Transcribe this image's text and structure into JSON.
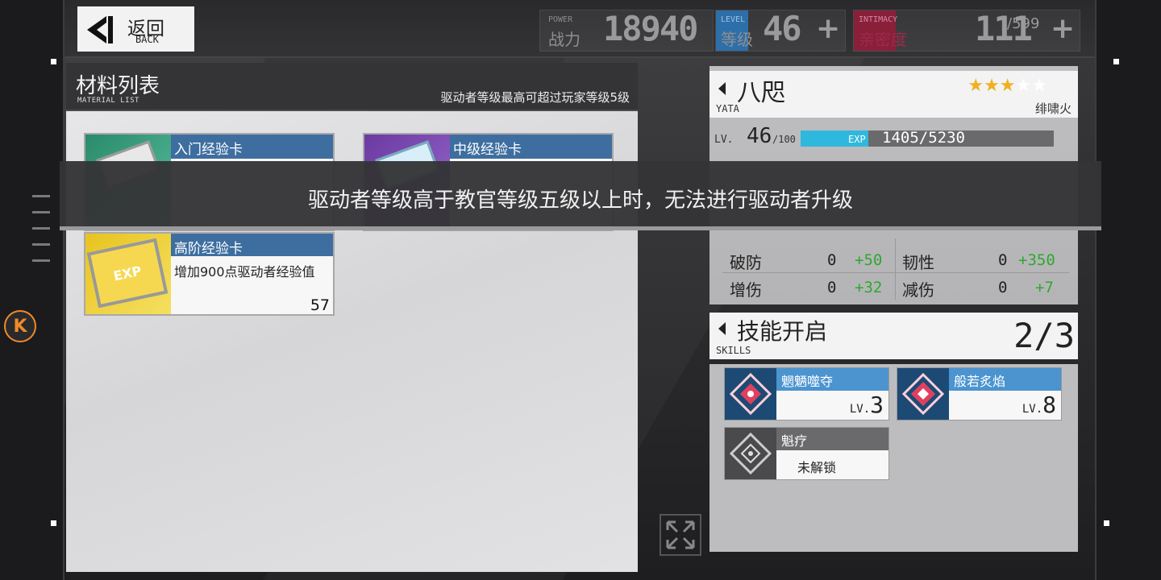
{
  "back": {
    "label": "返回",
    "sub": "BACK"
  },
  "top_stats": {
    "power": {
      "en": "POWER",
      "zh": "战力",
      "value": "18940"
    },
    "level": {
      "en": "LEVEL",
      "zh": "等级",
      "value": "46",
      "plus": "+"
    },
    "intimacy": {
      "en": "INTIMACY",
      "zh": "亲密度",
      "value": "111",
      "max": "/599",
      "plus": "+"
    }
  },
  "material_panel": {
    "title": "材料列表",
    "title_en": "MATERIAL LIST",
    "note": "驱动者等级最高可超过玩家等级5级",
    "items": [
      {
        "name": "入门经验卡",
        "color": "#2a8a6a"
      },
      {
        "name": "中级经验卡",
        "color": "#6a3aa0"
      },
      {
        "name": "高阶经验卡",
        "desc": "增加900点驱动者经验值",
        "count": "57",
        "color": "#e8c320",
        "img_text": "EXP"
      }
    ]
  },
  "character": {
    "name": "八咫",
    "name_en": "YATA",
    "attribute": "绯啸火",
    "stars_filled": 3,
    "stars_total": 5,
    "lv_label": "LV.",
    "level": "46",
    "level_max": "/100",
    "exp_label": "EXP",
    "exp_text": "1405/5230",
    "exp_current": 1405,
    "exp_total": 5230,
    "stats": [
      {
        "label": "破防",
        "value": "0",
        "add": "+50"
      },
      {
        "label": "韧性",
        "value": "0",
        "add": "+350"
      },
      {
        "label": "增伤",
        "value": "0",
        "add": "+32"
      },
      {
        "label": "减伤",
        "value": "0",
        "add": "+7"
      }
    ]
  },
  "banner": {
    "text": "驱动者等级高于教官等级五级以上时，无法进行驱动者升级"
  },
  "skills": {
    "title": "技能开启",
    "title_en": "SKILLS",
    "count": "2/3",
    "items": [
      {
        "name": "魍魉噬夺",
        "lv_label": "LV.",
        "lv": "3",
        "status": ""
      },
      {
        "name": "般若炙焰",
        "lv_label": "LV.",
        "lv": "8",
        "status": ""
      },
      {
        "name": "魁疗",
        "status": "未解锁"
      }
    ]
  },
  "colors": {
    "accent_blue": "#3e6ea0",
    "exp_blue": "#2fb8de",
    "add_green": "#2ea82e",
    "orange": "#f08a2a"
  }
}
